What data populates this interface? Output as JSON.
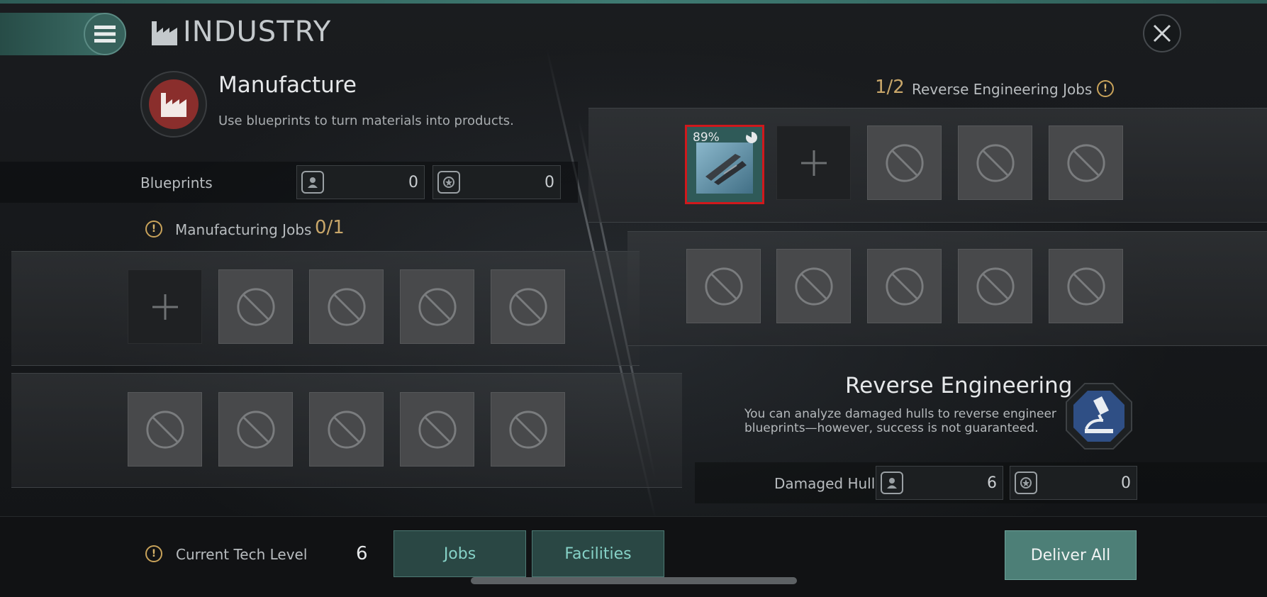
{
  "header": {
    "title": "INDUSTRY"
  },
  "manufacture": {
    "title": "Manufacture",
    "description": "Use blueprints to turn materials into products.",
    "blueprints_label": "Blueprints",
    "blueprint_counts": [
      "0",
      "0"
    ],
    "jobs_label": "Manufacturing Jobs",
    "jobs_count": "0/1"
  },
  "reverse_engineering": {
    "jobs_count": "1/2",
    "jobs_label": "Reverse Engineering Jobs",
    "active_item_progress": "89%",
    "title": "Reverse Engineering",
    "description": "You can analyze damaged hulls to reverse engineer blueprints—however, success is not guaranteed.",
    "damaged_hull_label": "Damaged Hull",
    "damaged_hull_counts": [
      "6",
      "0"
    ]
  },
  "footer": {
    "tech_level_label": "Current Tech Level",
    "tech_level_value": "6",
    "jobs_tab": "Jobs",
    "facilities_tab": "Facilities",
    "deliver_all": "Deliver All"
  },
  "colors": {
    "accent": "#4d7f77",
    "warning": "#c9a35a",
    "highlight": "#d0181c",
    "manufacture_icon": "#8a2e2c",
    "reverse_icon": "#2f4f85"
  }
}
